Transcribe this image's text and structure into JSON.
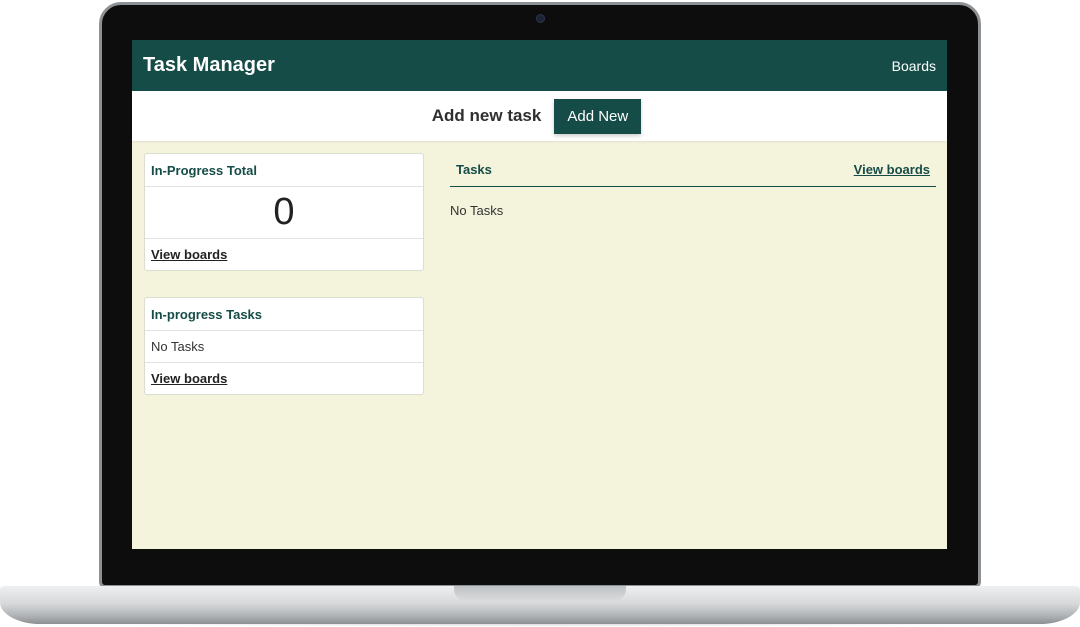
{
  "app": {
    "title": "Task Manager",
    "nav_boards": "Boards"
  },
  "action_bar": {
    "label": "Add new task",
    "add_button": "Add New"
  },
  "in_progress_total": {
    "title": "In-Progress Total",
    "count": "0",
    "link": "View boards"
  },
  "in_progress_tasks": {
    "title": "In-progress Tasks",
    "empty_text": "No Tasks",
    "link": "View boards"
  },
  "tasks": {
    "title": "Tasks",
    "link": "View boards",
    "empty_text": "No Tasks"
  },
  "colors": {
    "brand": "#164c47",
    "background": "#f4f3dc"
  }
}
